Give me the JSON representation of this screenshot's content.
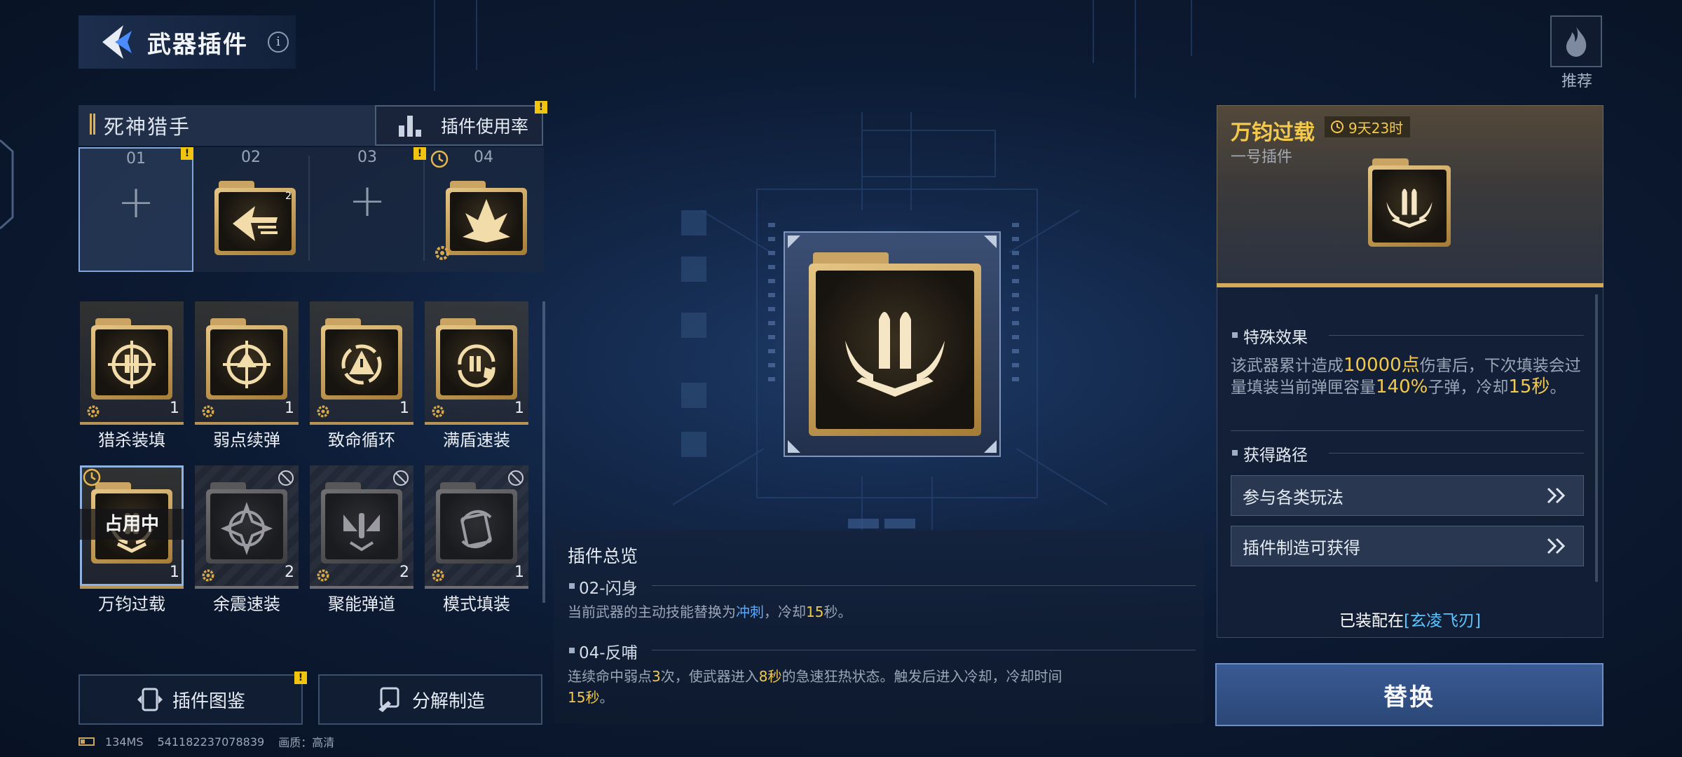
{
  "header": {
    "title": "武器插件",
    "info_icon": "i"
  },
  "recommend": {
    "label": "推荐"
  },
  "weapon": {
    "name": "死神猎手",
    "usage_button": "插件使用率"
  },
  "slots": [
    {
      "num": "01",
      "state": "empty",
      "badge": "!"
    },
    {
      "num": "02",
      "state": "filled",
      "level": "2"
    },
    {
      "num": "03",
      "state": "empty",
      "badge": "!"
    },
    {
      "num": "04",
      "state": "filled"
    }
  ],
  "slot_plus": "+",
  "plugins_row1": [
    {
      "name": "猎杀装填",
      "count": "1"
    },
    {
      "name": "弱点续弹",
      "count": "1"
    },
    {
      "name": "致命循环",
      "count": "1"
    },
    {
      "name": "满盾速装",
      "count": "1"
    }
  ],
  "plugins_row2": [
    {
      "name": "万钧过载",
      "count": "1",
      "overlay": "占用中"
    },
    {
      "name": "余震速装",
      "count": "2"
    },
    {
      "name": "聚能弹道",
      "count": "2"
    },
    {
      "name": "模式填装",
      "count": "1"
    }
  ],
  "bottom": {
    "catalog_button": "插件图鉴",
    "craft_button": "分解制造",
    "badge": "!"
  },
  "status": {
    "ping": "134MS",
    "uid": "541182237078839",
    "quality": "画质：高清"
  },
  "overview": {
    "title": "插件总览",
    "items": [
      {
        "head": "02-闪身",
        "desc_a": "当前武器的主动技能替换为",
        "desc_b": "冲刺",
        "desc_c": "，冷却",
        "desc_d": "15",
        "desc_e": "秒。"
      },
      {
        "head": "04-反哺",
        "desc_a": "连续命中弱点",
        "desc_b": "3",
        "desc_c": "次，使武器进入",
        "desc_d": "8秒",
        "desc_e": "的急速狂热状态。触发后进入冷却，冷却时间",
        "desc_f": "15秒",
        "desc_g": "。"
      }
    ]
  },
  "detail": {
    "title": "万钧过载",
    "timer": "9天23时",
    "subtitle": "一号插件",
    "effect_section": "特殊效果",
    "effect": {
      "a": "该武器累计造成",
      "b": "10000点",
      "c": "伤害后，下次填装会过量填装当前弹匣容量",
      "d": "140%",
      "e": "子弹，冷却",
      "f": "15秒",
      "g": "。"
    },
    "source_section": "获得路径",
    "sources": [
      "参与各类玩法",
      "插件制造可获得"
    ],
    "equipped_prefix": "已装配在",
    "equipped_weapon": "[玄凌飞刃]",
    "replace_button": "替换"
  },
  "colors": {
    "gold": "#d4a959",
    "highlight_yellow": "#f2c94c",
    "highlight_blue": "#59a8ff",
    "accent_blue": "#59c6ff"
  }
}
